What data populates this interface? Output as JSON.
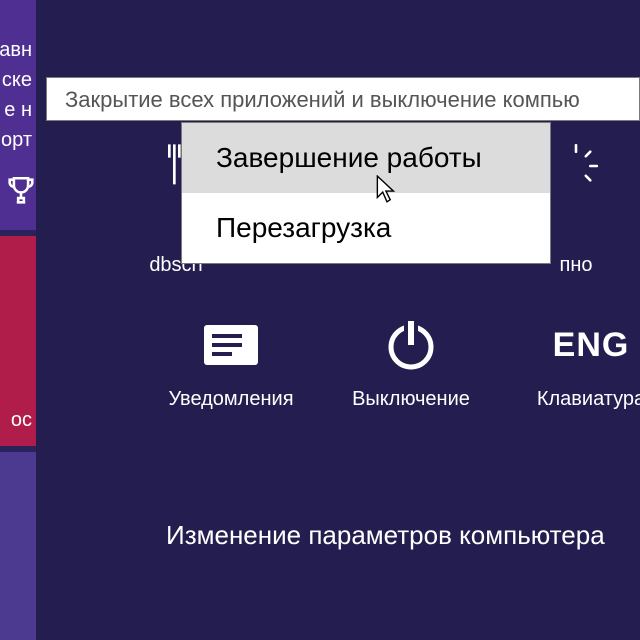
{
  "left_strip": {
    "text_fragments": [
      "авн",
      "ске",
      "е н",
      "орт",
      "ос"
    ]
  },
  "top_row": {
    "item0": {
      "label": "dbsch"
    },
    "item1": {
      "label": "пно"
    }
  },
  "quick_settings": {
    "notifications": {
      "label": "Уведомления"
    },
    "power": {
      "label": "Выключение"
    },
    "keyboard": {
      "label": "Клавиатура",
      "indicator": "ENG"
    }
  },
  "change_settings": "Изменение параметров компьютера",
  "tooltip": "Закрытие всех приложений и выключение компью",
  "power_menu": {
    "shutdown": "Завершение работы",
    "restart": "Перезагрузка"
  }
}
